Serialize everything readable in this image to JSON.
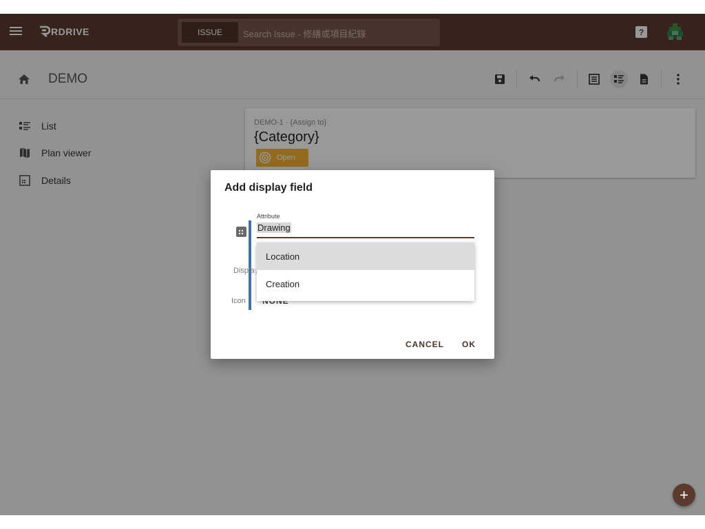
{
  "topbar": {
    "logo_text": "RDRIVE",
    "search_chip": "ISSUE",
    "search_placeholder": "Search Issue - 修繕或項目紀錄",
    "help_symbol": "?"
  },
  "header": {
    "project_title": "DEMO",
    "toolbar_icons": [
      "save-icon",
      "undo-icon",
      "redo-icon",
      "table-view-icon",
      "list-view-icon",
      "document-view-icon",
      "more-vert-icon"
    ]
  },
  "sidebar": {
    "items": [
      {
        "label": "List",
        "icon": "list-icon"
      },
      {
        "label": "Plan viewer",
        "icon": "map-icon"
      },
      {
        "label": "Details",
        "icon": "details-icon"
      }
    ]
  },
  "card": {
    "subtitle": "DEMO-1 · {Assign to}",
    "category": "{Category}",
    "status": "Open",
    "status_color": "#f4b533"
  },
  "dialog": {
    "title": "Add display field",
    "attribute_label": "Attribute",
    "attribute_value": "Drawing",
    "display_label_partial": "Displa",
    "display_label_overflow": "y",
    "icon_label": "Icon",
    "icon_value": "NONE",
    "dropdown_options": [
      {
        "label": "Location",
        "highlighted": true
      },
      {
        "label": "Creation",
        "highlighted": false
      }
    ],
    "cancel_label": "CANCEL",
    "ok_label": "OK"
  },
  "fab": {
    "symbol": "+"
  },
  "colors": {
    "brand": "#5a3b2e",
    "accent_blue": "#3f6fb5",
    "status_open": "#f4b533"
  }
}
